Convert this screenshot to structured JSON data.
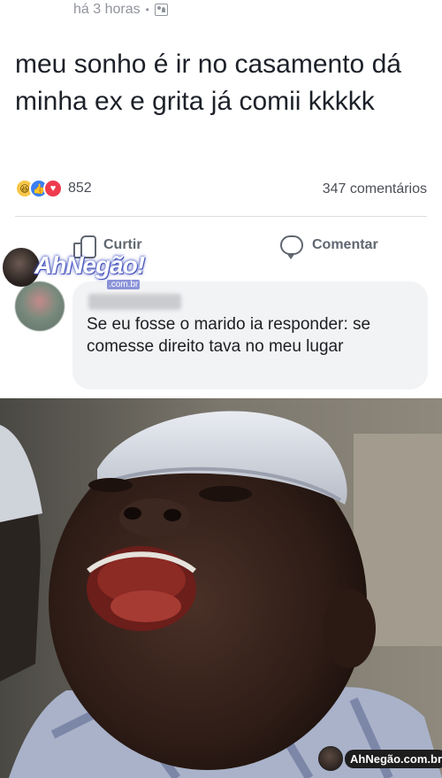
{
  "post": {
    "timestamp": "há 3 horas",
    "separator": "•",
    "privacy_icon": "friends-icon",
    "text": "meu sonho é ir no casamento dá minha ex e grita já comii kkkkk",
    "reactions": {
      "icons": [
        "haha-icon",
        "like-icon",
        "love-icon"
      ],
      "count": "852"
    },
    "comments_count": "347 comentários",
    "actions": {
      "like_label": "Curtir",
      "comment_label": "Comentar"
    }
  },
  "comment": {
    "text": "Se eu fosse o marido ia responder: se comesse direito tava no meu lugar"
  },
  "watermark": {
    "top_text": "AhNegão!",
    "top_sub": ".com.br",
    "bottom_text": "AhNegão.com.br"
  },
  "colors": {
    "text_secondary": "#90949c",
    "comment_bg": "#f2f3f5",
    "like_blue": "#3b7ff3",
    "love_red": "#ee3b4e",
    "haha_yellow": "#f7c74a"
  }
}
